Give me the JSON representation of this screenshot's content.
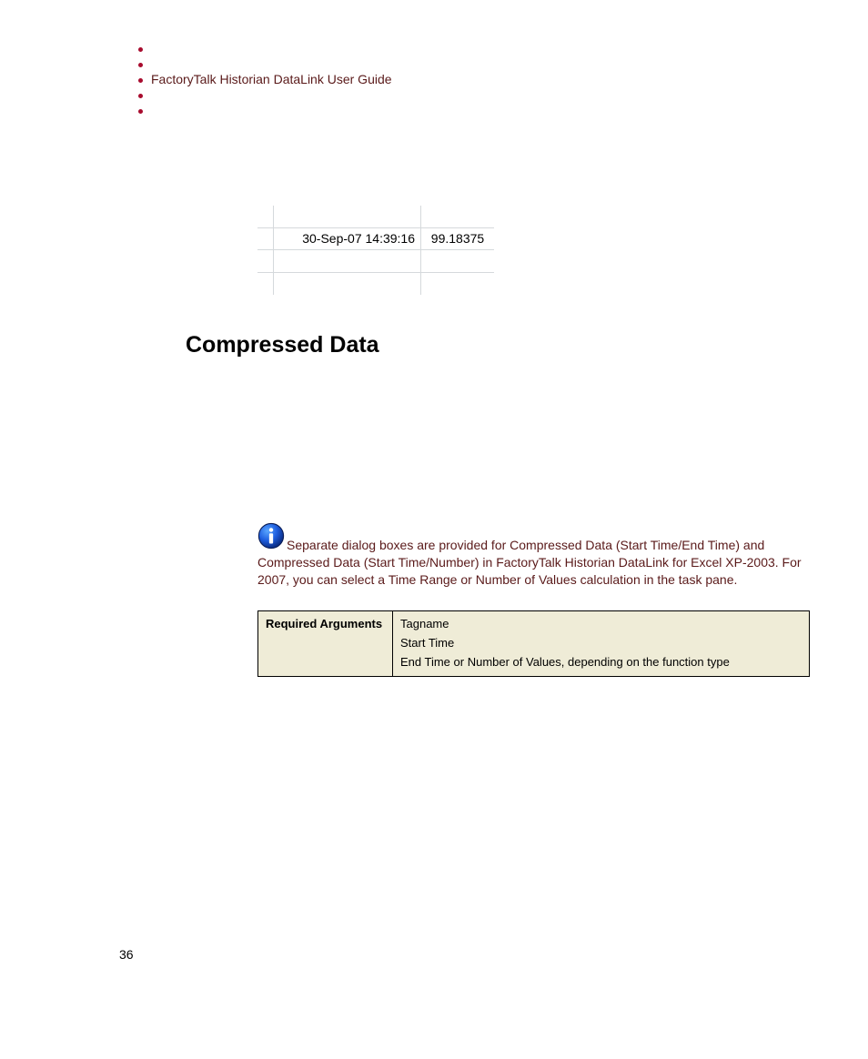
{
  "header": {
    "title": "FactoryTalk Historian DataLink User Guide"
  },
  "spreadsheet": {
    "timestamp": "30-Sep-07 14:39:16",
    "value": "99.18375"
  },
  "section": {
    "heading": "Compressed Data"
  },
  "note": {
    "text": "Separate dialog boxes are provided for Compressed Data (Start Time/End Time) and Compressed Data (Start Time/Number) in FactoryTalk Historian DataLink for Excel XP-2003. For 2007, you can select a Time Range or Number of Values calculation in the task pane."
  },
  "requirements": {
    "label": "Required Arguments",
    "args": [
      "Tagname",
      "Start Time",
      "End Time or Number of Values, depending on the function type"
    ]
  },
  "page_number": "36"
}
